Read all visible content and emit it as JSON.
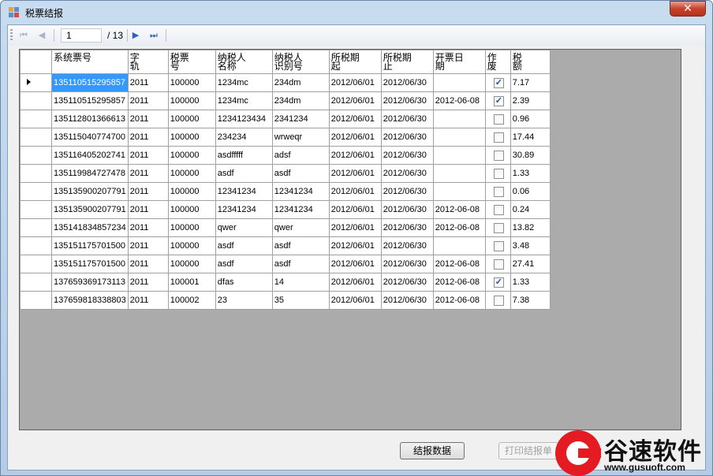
{
  "window": {
    "title": "税票结报",
    "close_label": "✕"
  },
  "navigator": {
    "position": "1",
    "count_label": "/ 13"
  },
  "grid": {
    "columns": [
      "系统票号",
      "字轨",
      "税票号",
      "纳税人名称",
      "纳税人识别号",
      "所税期起",
      "所税期止",
      "开票日期",
      "作废",
      "税额"
    ],
    "header_lines": [
      [
        "系统票号"
      ],
      [
        "字",
        "轨"
      ],
      [
        "税票",
        "号"
      ],
      [
        "纳税人",
        "名称"
      ],
      [
        "纳税人",
        "识别号"
      ],
      [
        "所税期",
        "起"
      ],
      [
        "所税期",
        "止"
      ],
      [
        "开票日",
        "期"
      ],
      [
        "作",
        "废"
      ],
      [
        "税",
        "额"
      ]
    ],
    "rows": [
      {
        "sys_no": "135110515295857",
        "track": "2011",
        "tax_no": "100000",
        "name": "1234mc",
        "id": "234dm",
        "start": "2012/06/01",
        "end": "2012/06/30",
        "issue_date": "",
        "void": true,
        "amount": "7.17"
      },
      {
        "sys_no": "135110515295857",
        "track": "2011",
        "tax_no": "100000",
        "name": "1234mc",
        "id": "234dm",
        "start": "2012/06/01",
        "end": "2012/06/30",
        "issue_date": "2012-06-08",
        "void": true,
        "amount": "2.39"
      },
      {
        "sys_no": "135112801366613",
        "track": "2011",
        "tax_no": "100000",
        "name": "1234123434",
        "id": "2341234",
        "start": "2012/06/01",
        "end": "2012/06/30",
        "issue_date": "",
        "void": false,
        "amount": "0.96"
      },
      {
        "sys_no": "135115040774700",
        "track": "2011",
        "tax_no": "100000",
        "name": "234234",
        "id": "wrweqr",
        "start": "2012/06/01",
        "end": "2012/06/30",
        "issue_date": "",
        "void": false,
        "amount": "17.44"
      },
      {
        "sys_no": "135116405202741",
        "track": "2011",
        "tax_no": "100000",
        "name": "asdfffff",
        "id": "adsf",
        "start": "2012/06/01",
        "end": "2012/06/30",
        "issue_date": "",
        "void": false,
        "amount": "30.89"
      },
      {
        "sys_no": "135119984727478",
        "track": "2011",
        "tax_no": "100000",
        "name": "asdf",
        "id": "asdf",
        "start": "2012/06/01",
        "end": "2012/06/30",
        "issue_date": "",
        "void": false,
        "amount": "1.33"
      },
      {
        "sys_no": "135135900207791",
        "track": "2011",
        "tax_no": "100000",
        "name": "12341234",
        "id": "12341234",
        "start": "2012/06/01",
        "end": "2012/06/30",
        "issue_date": "",
        "void": false,
        "amount": "0.06"
      },
      {
        "sys_no": "135135900207791",
        "track": "2011",
        "tax_no": "100000",
        "name": "12341234",
        "id": "12341234",
        "start": "2012/06/01",
        "end": "2012/06/30",
        "issue_date": "2012-06-08",
        "void": false,
        "amount": "0.24"
      },
      {
        "sys_no": "135141834857234",
        "track": "2011",
        "tax_no": "100000",
        "name": "qwer",
        "id": "qwer",
        "start": "2012/06/01",
        "end": "2012/06/30",
        "issue_date": "2012-06-08",
        "void": false,
        "amount": "13.82"
      },
      {
        "sys_no": "135151175701500",
        "track": "2011",
        "tax_no": "100000",
        "name": "asdf",
        "id": "asdf",
        "start": "2012/06/01",
        "end": "2012/06/30",
        "issue_date": "",
        "void": false,
        "amount": "3.48"
      },
      {
        "sys_no": "135151175701500",
        "track": "2011",
        "tax_no": "100000",
        "name": "asdf",
        "id": "asdf",
        "start": "2012/06/01",
        "end": "2012/06/30",
        "issue_date": "2012-06-08",
        "void": false,
        "amount": "27.41"
      },
      {
        "sys_no": "137659369173113",
        "track": "2011",
        "tax_no": "100001",
        "name": "dfas",
        "id": "14",
        "start": "2012/06/01",
        "end": "2012/06/30",
        "issue_date": "2012-06-08",
        "void": true,
        "amount": "1.33"
      },
      {
        "sys_no": "137659818338803",
        "track": "2011",
        "tax_no": "100002",
        "name": "23",
        "id": "35",
        "start": "2012/06/01",
        "end": "2012/06/30",
        "issue_date": "2012-06-08",
        "void": false,
        "amount": "7.38"
      }
    ]
  },
  "buttons": {
    "submit_label": "结报数据",
    "print_label": "打印结报单"
  },
  "watermark": {
    "brand": "谷速软件",
    "url": "www.gusuoft.com"
  },
  "colors": {
    "selection": "#3399ff",
    "grid_background": "#ababab",
    "close_button": "#c7422b",
    "watermark_red": "#e51b24"
  }
}
